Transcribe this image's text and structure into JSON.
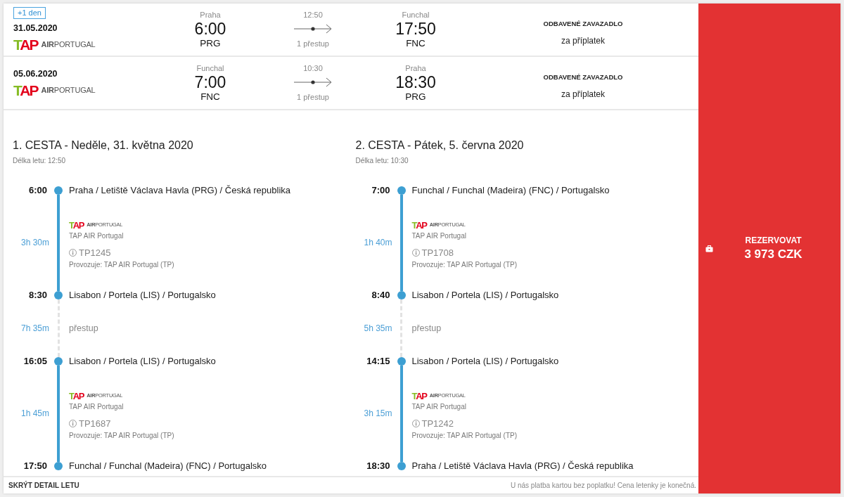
{
  "flights": [
    {
      "badge": "+1 den",
      "date": "31.05.2020",
      "airline_logo": {
        "mark": "TAP",
        "wordmark": "**AIR**PORTUGAL"
      },
      "departure": {
        "city": "Praha",
        "time": "6:00",
        "code": "PRG"
      },
      "duration": "12:50",
      "stops": "1 přestup",
      "arrival": {
        "city": "Funchal",
        "time": "17:50",
        "code": "FNC"
      },
      "baggage": {
        "title": "ODBAVENÉ ZAVAZADLO",
        "note": "za příplatek"
      }
    },
    {
      "date": "05.06.2020",
      "airline_logo": {
        "mark": "TAP",
        "wordmark": "**AIR**PORTUGAL"
      },
      "departure": {
        "city": "Funchal",
        "time": "7:00",
        "code": "FNC"
      },
      "duration": "10:30",
      "stops": "1 přestup",
      "arrival": {
        "city": "Praha",
        "time": "18:30",
        "code": "PRG"
      },
      "baggage": {
        "title": "ODBAVENÉ ZAVAZADLO",
        "note": "za příplatek"
      }
    }
  ],
  "journeys": [
    {
      "title": "1. CESTA - Neděle, 31. května 2020",
      "flight_length": "Délka letu: 12:50",
      "steps": [
        {
          "kind": "stop",
          "time": "6:00",
          "place": "Praha / Letiště Václava Havla (PRG) / Česká republika"
        },
        {
          "kind": "segment",
          "duration": "3h 30m",
          "airline_logo": {
            "mark": "TAP",
            "wordmark": "**AIR**PORTUGAL"
          },
          "airline": "TAP AIR Portugal",
          "flight_number": "TP1245",
          "operator": "Provozuje: TAP AIR Portugal (TP)"
        },
        {
          "kind": "stop",
          "time": "8:30",
          "place": "Lisabon / Portela (LIS) / Portugalsko"
        },
        {
          "kind": "layover",
          "duration": "7h 35m",
          "label": "přestup"
        },
        {
          "kind": "stop",
          "time": "16:05",
          "place": "Lisabon / Portela (LIS) / Portugalsko"
        },
        {
          "kind": "segment",
          "duration": "1h 45m",
          "airline_logo": {
            "mark": "TAP",
            "wordmark": "**AIR**PORTUGAL"
          },
          "airline": "TAP AIR Portugal",
          "flight_number": "TP1687",
          "operator": "Provozuje: TAP AIR Portugal (TP)"
        },
        {
          "kind": "stop",
          "time": "17:50",
          "place": "Funchal / Funchal (Madeira) (FNC) / Portugalsko"
        }
      ]
    },
    {
      "title": "2. CESTA - Pátek, 5. června 2020",
      "flight_length": "Délka letu: 10:30",
      "steps": [
        {
          "kind": "stop",
          "time": "7:00",
          "place": "Funchal / Funchal (Madeira) (FNC) / Portugalsko"
        },
        {
          "kind": "segment",
          "duration": "1h 40m",
          "airline_logo": {
            "mark": "TAP",
            "wordmark": "**AIR**PORTUGAL"
          },
          "airline": "TAP AIR Portugal",
          "flight_number": "TP1708",
          "operator": "Provozuje: TAP AIR Portugal (TP)"
        },
        {
          "kind": "stop",
          "time": "8:40",
          "place": "Lisabon / Portela (LIS) / Portugalsko"
        },
        {
          "kind": "layover",
          "duration": "5h 35m",
          "label": "přestup"
        },
        {
          "kind": "stop",
          "time": "14:15",
          "place": "Lisabon / Portela (LIS) / Portugalsko"
        },
        {
          "kind": "segment",
          "duration": "3h 15m",
          "airline_logo": {
            "mark": "TAP",
            "wordmark": "**AIR**PORTUGAL"
          },
          "airline": "TAP AIR Portugal",
          "flight_number": "TP1242",
          "operator": "Provozuje: TAP AIR Portugal (TP)"
        },
        {
          "kind": "stop",
          "time": "18:30",
          "place": "Praha / Letiště Václava Havla (PRG) / Česká republika"
        }
      ]
    }
  ],
  "footer": {
    "toggle": "SKRÝT DETAIL LETU",
    "note": "U nás platba kartou bez poplatku! Cena letenky je konečná."
  },
  "book_button": {
    "label": "REZERVOVAT",
    "price": "3 973 CZK"
  }
}
